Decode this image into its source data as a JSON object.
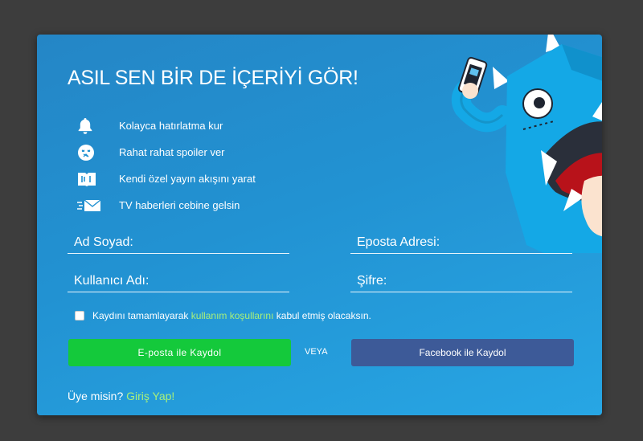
{
  "title": "ASIL SEN BİR DE İÇERİYİ GÖR!",
  "features": [
    {
      "icon": "bell-icon",
      "label": "Kolayca hatırlatma kur"
    },
    {
      "icon": "spoiler-face-icon",
      "label": "Rahat rahat spoiler ver"
    },
    {
      "icon": "feed-icon",
      "label": "Kendi özel yayın akışını yarat"
    },
    {
      "icon": "mail-icon",
      "label": "TV haberleri cebine gelsin"
    }
  ],
  "form": {
    "name_placeholder": "Ad Soyad:",
    "email_placeholder": "Eposta Adresi:",
    "username_placeholder": "Kullanıcı Adı:",
    "password_placeholder": "Şifre:"
  },
  "terms": {
    "before": "Kaydını tamamlayarak ",
    "link": "kullanım koşullarını",
    "after": " kabul etmiş olacaksın."
  },
  "buttons": {
    "email_signup": "E-posta ile Kaydol",
    "or": "VEYA",
    "facebook_signup": "Facebook ile Kaydol"
  },
  "login": {
    "prompt": "Üye misin? ",
    "link": "Giriş Yap!"
  },
  "colors": {
    "modal_blue": "#2292d2",
    "email_green": "#14c93b",
    "facebook_blue": "#3d5a98",
    "link_green": "#a8f07a"
  }
}
